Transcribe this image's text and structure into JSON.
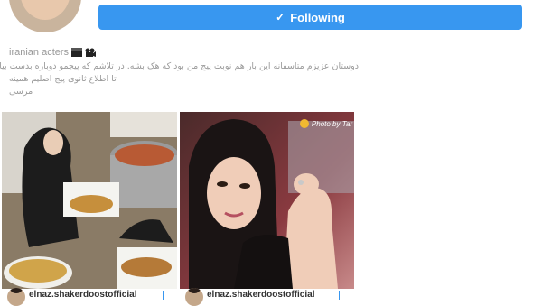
{
  "follow_button": {
    "label": "Following"
  },
  "bio": {
    "name": "iranian acters",
    "line1": "دوستان عزیزم متاسفانه این بار هم نوبت پیج من بود که هک بشه. در تلاشم که پیجمو دوباره بدست بیارم",
    "line2": "تا اطلاع ثانوی پیج اصلیم همینه",
    "line3": "مرسی"
  },
  "posts": [
    {
      "username": "elnaz.shakerdoostofficial"
    },
    {
      "username": "elnaz.shakerdoostofficial",
      "photo_credit": "Photo by Tar"
    }
  ],
  "colors": {
    "accent": "#3897f0",
    "muted": "#999999"
  },
  "icons": [
    "check-icon",
    "clapperboard-icon",
    "movie-camera-icon",
    "sun-icon"
  ]
}
